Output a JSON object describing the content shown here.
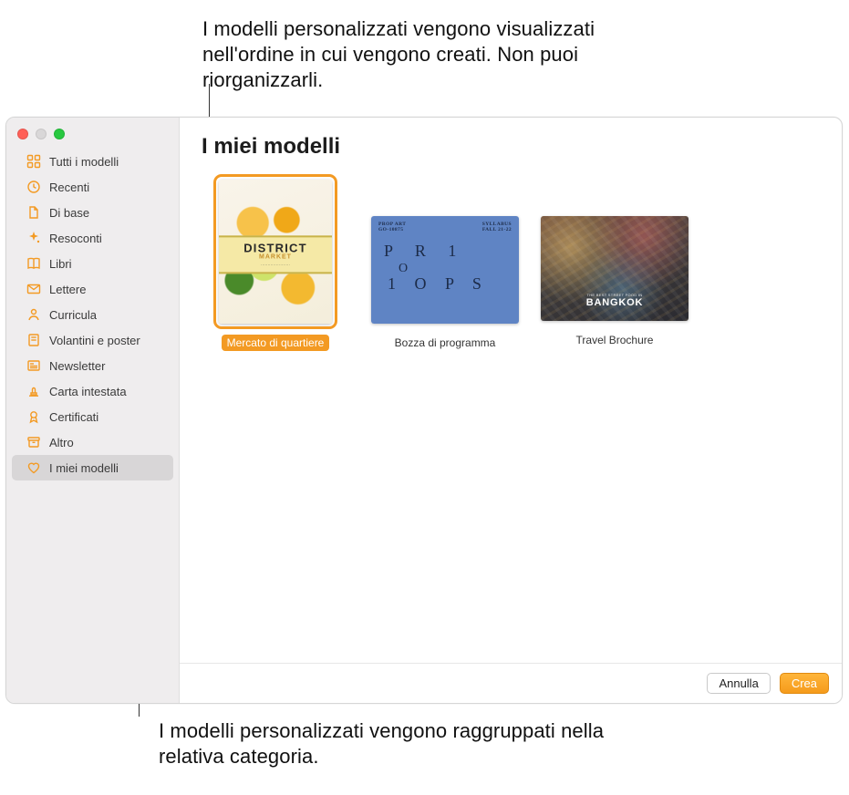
{
  "annotations": {
    "top": "I modelli personalizzati vengono visualizzati nell'ordine in cui vengono creati. Non puoi riorganizzarli.",
    "bottom": "I modelli personalizzati vengono raggruppati nella relativa categoria."
  },
  "sidebar": {
    "items": [
      {
        "label": "Tutti i modelli",
        "icon": "grid"
      },
      {
        "label": "Recenti",
        "icon": "clock"
      },
      {
        "label": "Di base",
        "icon": "doc"
      },
      {
        "label": "Resoconti",
        "icon": "sparkle"
      },
      {
        "label": "Libri",
        "icon": "book"
      },
      {
        "label": "Lettere",
        "icon": "envelope"
      },
      {
        "label": "Curricula",
        "icon": "person"
      },
      {
        "label": "Volantini e poster",
        "icon": "poster"
      },
      {
        "label": "Newsletter",
        "icon": "news"
      },
      {
        "label": "Carta intestata",
        "icon": "stamp"
      },
      {
        "label": "Certificati",
        "icon": "ribbon"
      },
      {
        "label": "Altro",
        "icon": "box"
      },
      {
        "label": "I miei modelli",
        "icon": "heart"
      }
    ],
    "selected_index": 12
  },
  "main": {
    "title": "I miei modelli",
    "templates": [
      {
        "label": "Mercato di quartiere",
        "selected": true,
        "thumb": {
          "line1": "DISTRICT",
          "line2": "MARKET"
        }
      },
      {
        "label": "Bozza di programma",
        "selected": false,
        "thumb": {
          "hdr_left": "PROP ART\nGO-10875",
          "hdr_right": "SYLLABUS\nFALL 21-22",
          "word_row1": "P R   1",
          "word_row2": "  O",
          "word_row3": "1 O P S"
        }
      },
      {
        "label": "Travel Brochure",
        "selected": false,
        "thumb": {
          "tag1": "THE BEST STREET FOOD IN",
          "tag2": "BANGKOK"
        }
      }
    ]
  },
  "footer": {
    "cancel": "Annulla",
    "create": "Crea"
  }
}
